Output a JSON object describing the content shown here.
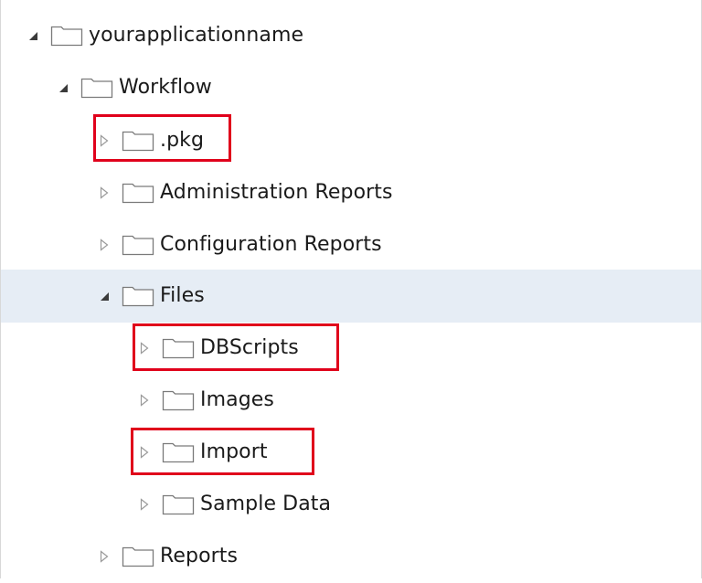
{
  "tree": {
    "root": {
      "label": "yourapplicationname",
      "expanded": true
    },
    "workflow": {
      "label": "Workflow",
      "expanded": true
    },
    "pkg": {
      "label": ".pkg",
      "expanded": false,
      "highlighted": true
    },
    "administration_reports": {
      "label": "Administration Reports",
      "expanded": false
    },
    "configuration_reports": {
      "label": "Configuration Reports",
      "expanded": false
    },
    "files": {
      "label": "Files",
      "expanded": true,
      "selected": true
    },
    "dbscripts": {
      "label": "DBScripts",
      "expanded": false,
      "highlighted": true
    },
    "images": {
      "label": "Images",
      "expanded": false
    },
    "import": {
      "label": "Import",
      "expanded": false,
      "highlighted": true
    },
    "sample_data": {
      "label": "Sample Data",
      "expanded": false
    },
    "reports": {
      "label": "Reports",
      "expanded": false
    }
  },
  "colors": {
    "highlight_border": "#e0001b",
    "selected_row": "#e6edf5",
    "folder_stroke": "#7a7a7a"
  },
  "icons": {
    "expanded_toggle": "triangle-expanded-icon",
    "collapsed_toggle": "triangle-collapsed-icon",
    "folder": "folder-icon"
  }
}
